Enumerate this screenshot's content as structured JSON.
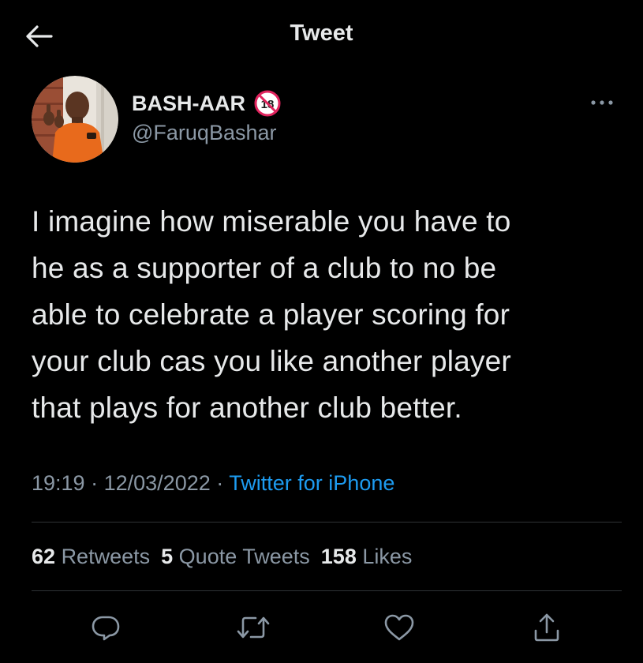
{
  "header": {
    "title": "Tweet",
    "back_icon": "arrow-left-icon"
  },
  "author": {
    "display_name": "BASH-AAR",
    "badge_text": "18",
    "badge_icon": "no-under-18-icon",
    "handle": "@FaruqBashar",
    "more_icon": "more-horizontal-icon"
  },
  "tweet": {
    "lines": [
      "I imagine how miserable you have to",
      "he as a supporter of a club to no be",
      "able to celebrate a player scoring for",
      "your club cas you like another player",
      "that plays for another club better."
    ]
  },
  "meta": {
    "time": "19:19",
    "separator": "·",
    "date": "12/03/2022",
    "source": "Twitter for iPhone"
  },
  "stats": {
    "retweets_count": "62",
    "retweets_label": "Retweets",
    "quotes_count": "5",
    "quotes_label": "Quote Tweets",
    "likes_count": "158",
    "likes_label": "Likes"
  },
  "actions": {
    "reply_icon": "reply-icon",
    "retweet_icon": "retweet-icon",
    "like_icon": "heart-icon",
    "share_icon": "share-icon"
  },
  "colors": {
    "background": "#000000",
    "text_primary": "#e7e9ea",
    "text_secondary": "#8b98a5",
    "accent": "#1d9bf0",
    "divider": "#2f3336",
    "badge_red": "#e0245e"
  }
}
